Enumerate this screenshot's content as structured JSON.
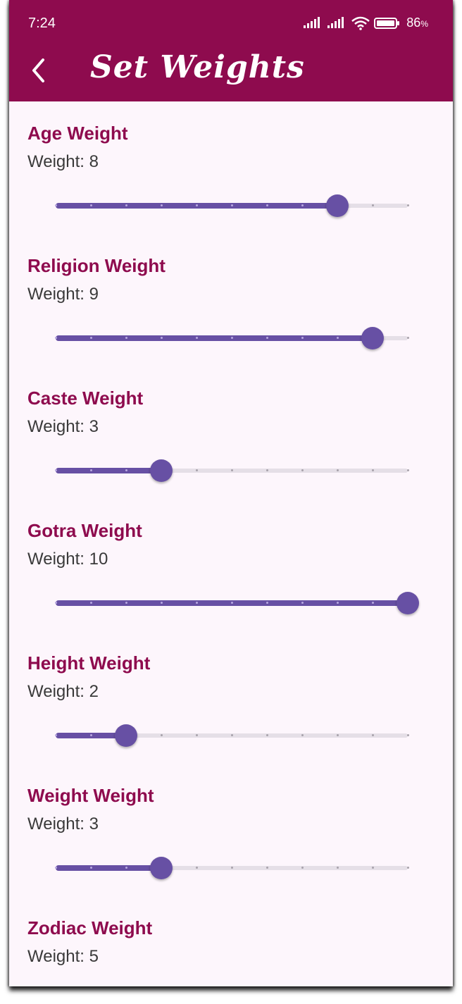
{
  "status_bar": {
    "time": "7:24",
    "battery_percent": "86",
    "battery_unit": "%",
    "icons": [
      "signal-icon",
      "signal-icon",
      "wifi-icon",
      "battery-icon"
    ]
  },
  "app_bar": {
    "title": "Set Weights",
    "back_icon": "chevron-left-icon"
  },
  "colors": {
    "app_bar": "#8e0b4e",
    "label": "#8e0b4e",
    "slider_active": "#6750a4",
    "slider_inactive": "#e5dfe7",
    "background": "#fdf6fc"
  },
  "slider_range": {
    "min": 0,
    "max": 10,
    "step": 1
  },
  "weights": [
    {
      "label": "Age Weight",
      "value_text": "Weight: 8",
      "value": 8
    },
    {
      "label": "Religion Weight",
      "value_text": "Weight: 9",
      "value": 9
    },
    {
      "label": "Caste Weight",
      "value_text": "Weight: 3",
      "value": 3
    },
    {
      "label": "Gotra Weight",
      "value_text": "Weight: 10",
      "value": 10
    },
    {
      "label": "Height Weight",
      "value_text": "Weight: 2",
      "value": 2
    },
    {
      "label": "Weight Weight",
      "value_text": "Weight: 3",
      "value": 3
    },
    {
      "label": "Zodiac Weight",
      "value_text": "Weight: 5",
      "value": 5
    }
  ]
}
